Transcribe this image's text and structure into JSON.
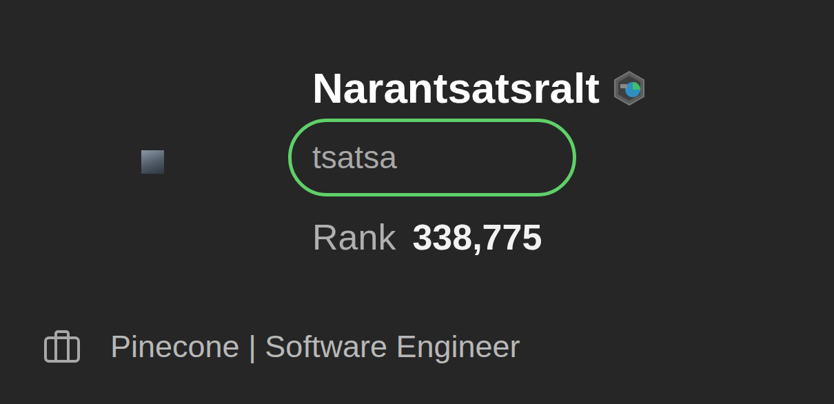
{
  "profile": {
    "display_name": "Narantsatsralt",
    "username": "tsatsa",
    "username_highlighted": true,
    "rank_label": "Rank",
    "rank": "338,775",
    "company": "Pinecone | Software Engineer"
  }
}
